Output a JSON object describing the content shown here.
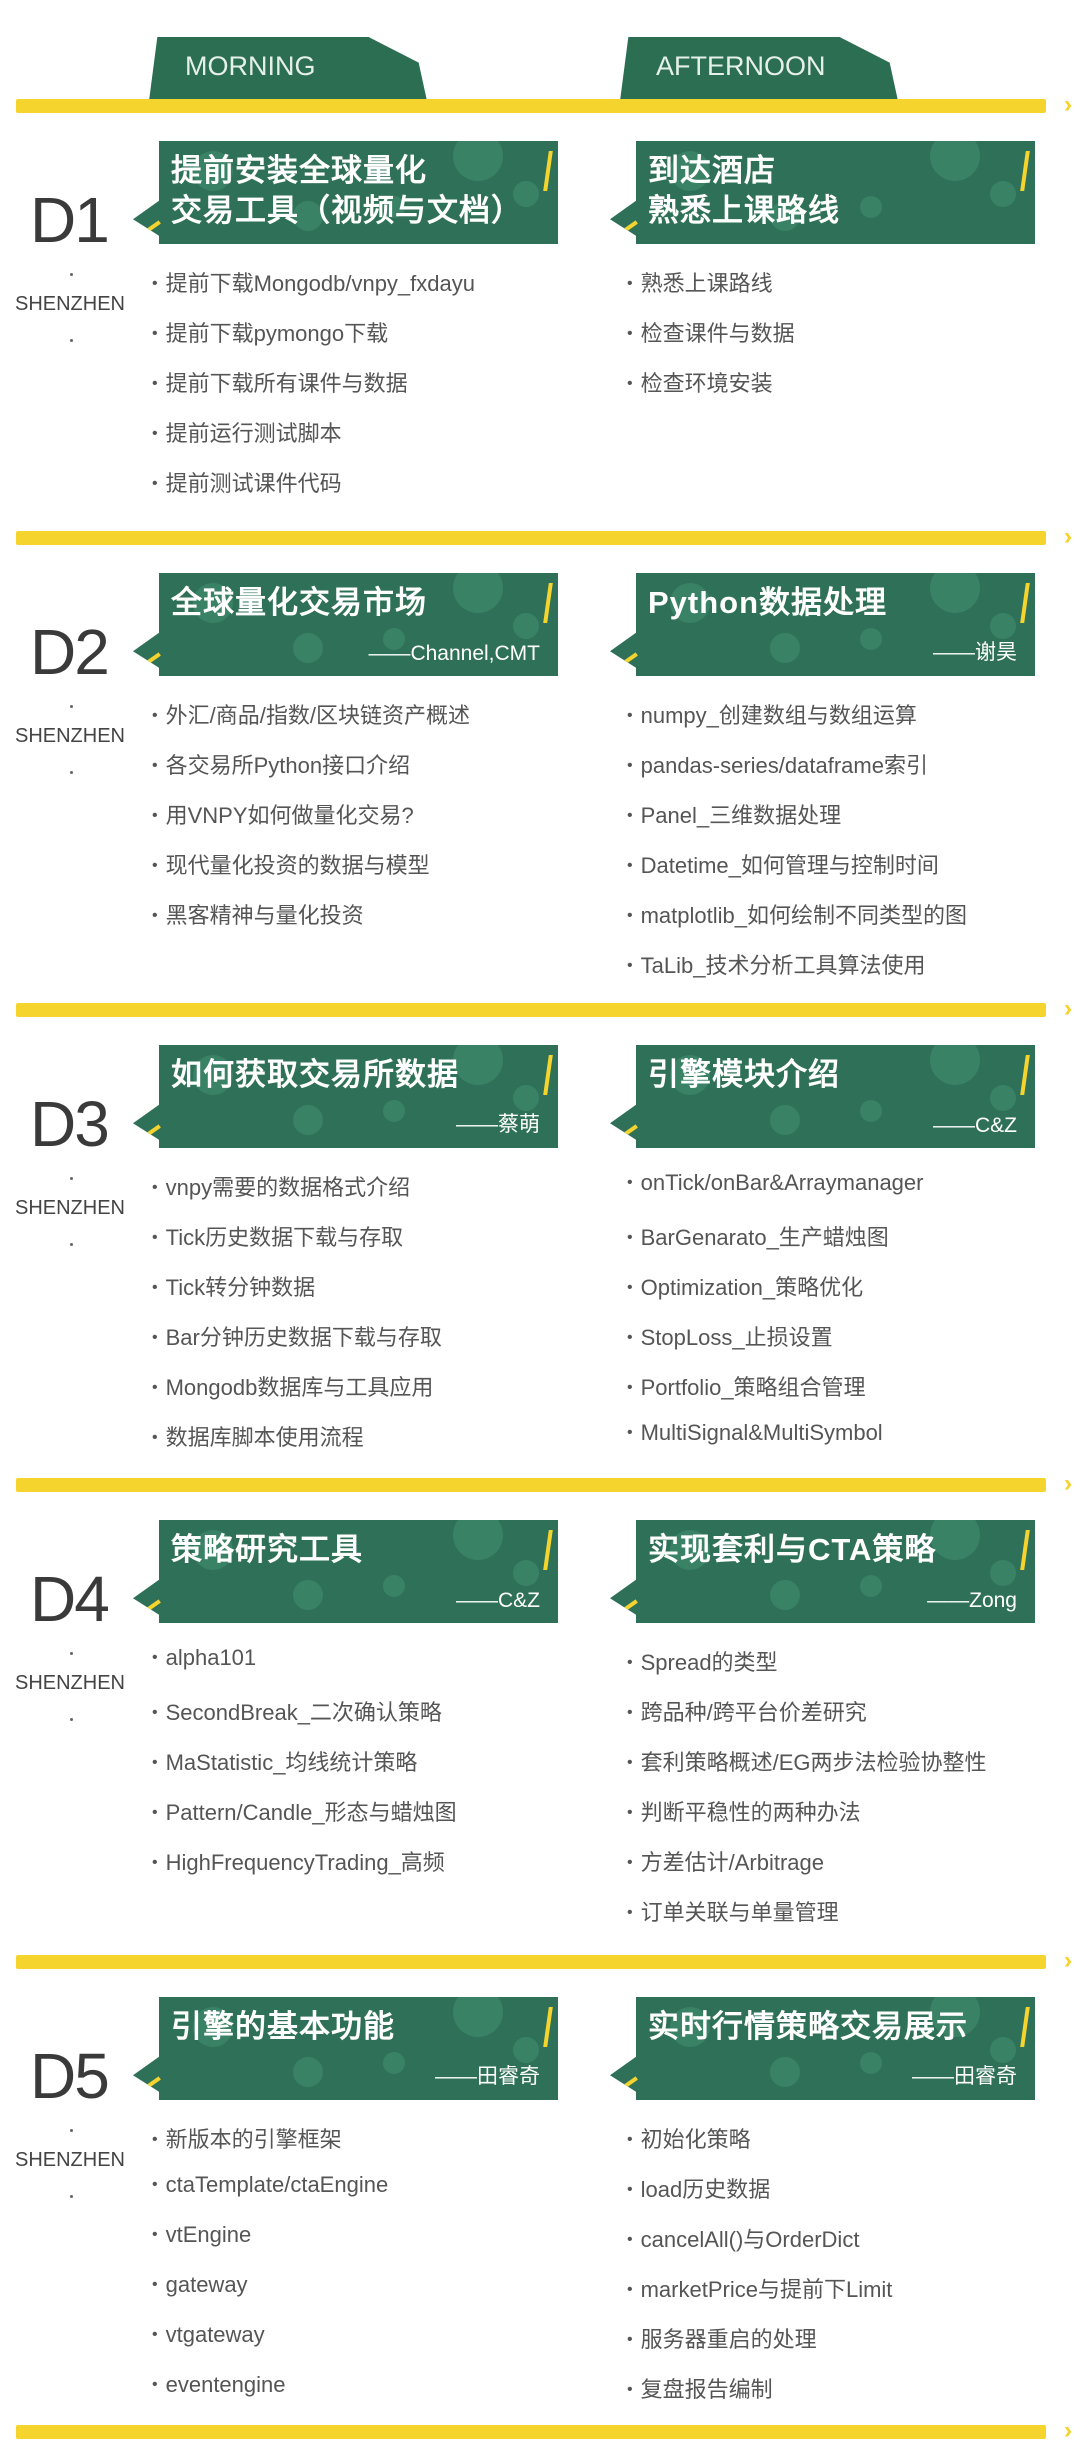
{
  "header": {
    "morning": "MORNING",
    "afternoon": "AFTERNOON"
  },
  "colors": {
    "green": "#2f7058",
    "yellow": "#f6d42e",
    "text": "#555555"
  },
  "days": [
    {
      "label": "D1",
      "city": "SHENZHEN",
      "morning": {
        "title": "提前安装全球量化\n交易工具（视频与文档）",
        "speaker": "",
        "items": [
          "提前下载Mongodb/vnpy_fxdayu",
          "提前下载pymongo下载",
          "提前下载所有课件与数据",
          "提前运行测试脚本",
          "提前测试课件代码"
        ]
      },
      "afternoon": {
        "title": "到达酒店\n熟悉上课路线",
        "speaker": "",
        "items": [
          "熟悉上课路线",
          "检查课件与数据",
          "检查环境安装"
        ]
      }
    },
    {
      "label": "D2",
      "city": "SHENZHEN",
      "morning": {
        "title": "全球量化交易市场",
        "speaker": "——Channel,CMT",
        "items": [
          "外汇/商品/指数/区块链资产概述",
          "各交易所Python接口介绍",
          "用VNPY如何做量化交易?",
          "现代量化投资的数据与模型",
          "黑客精神与量化投资"
        ]
      },
      "afternoon": {
        "title": "Python数据处理",
        "speaker": "——谢昊",
        "items": [
          "numpy_创建数组与数组运算",
          "pandas-series/dataframe索引",
          "Panel_三维数据处理",
          "Datetime_如何管理与控制时间",
          "matplotlib_如何绘制不同类型的图",
          "TaLib_技术分析工具算法使用"
        ]
      }
    },
    {
      "label": "D3",
      "city": "SHENZHEN",
      "morning": {
        "title": "如何获取交易所数据",
        "speaker": "——蔡萌",
        "items": [
          "vnpy需要的数据格式介绍",
          "Tick历史数据下载与存取",
          "Tick转分钟数据",
          "Bar分钟历史数据下载与存取",
          "Mongodb数据库与工具应用",
          "数据库脚本使用流程"
        ]
      },
      "afternoon": {
        "title": "引擎模块介绍",
        "speaker": "——C&Z",
        "items": [
          "onTick/onBar&Arraymanager",
          "BarGenarato_生产蜡烛图",
          "Optimization_策略优化",
          "StopLoss_止损设置",
          "Portfolio_策略组合管理",
          "MultiSignal&MultiSymbol"
        ]
      }
    },
    {
      "label": "D4",
      "city": "SHENZHEN",
      "morning": {
        "title": "策略研究工具",
        "speaker": "——C&Z",
        "items": [
          "alpha101",
          "SecondBreak_二次确认策略",
          "MaStatistic_均线统计策略",
          "Pattern/Candle_形态与蜡烛图",
          "HighFrequencyTrading_高频"
        ]
      },
      "afternoon": {
        "title": "实现套利与CTA策略",
        "speaker": "——Zong",
        "items": [
          "Spread的类型",
          "跨品种/跨平台价差研究",
          "套利策略概述/EG两步法检验协整性",
          "判断平稳性的两种办法",
          "方差估计/Arbitrage",
          "订单关联与单量管理"
        ]
      }
    },
    {
      "label": "D5",
      "city": "SHENZHEN",
      "morning": {
        "title": "引擎的基本功能",
        "speaker": "——田睿奇",
        "items": [
          "新版本的引擎框架",
          "ctaTemplate/ctaEngine",
          "vtEngine",
          "gateway",
          "vtgateway",
          "eventengine"
        ]
      },
      "afternoon": {
        "title": "实时行情策略交易展示",
        "speaker": "——田睿奇",
        "items": [
          "初始化策略",
          "load历史数据",
          "cancelAll()与OrderDict",
          "marketPrice与提前下Limit",
          "服务器重启的处理",
          "复盘报告编制"
        ]
      }
    }
  ]
}
